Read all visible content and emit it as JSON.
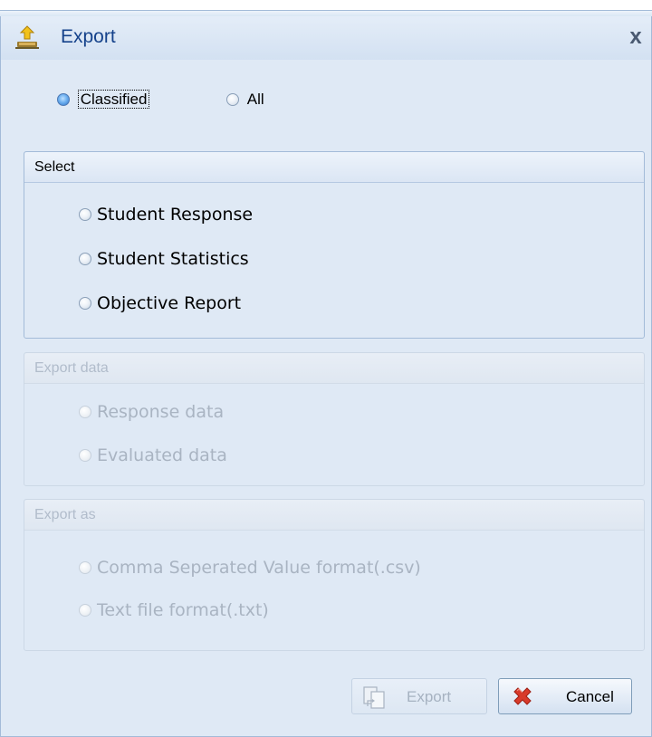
{
  "window": {
    "title": "Export",
    "close_label": "x"
  },
  "mode": {
    "options": [
      {
        "label": "Classified",
        "selected": true
      },
      {
        "label": "All",
        "selected": false
      }
    ]
  },
  "select_group": {
    "title": "Select",
    "options": [
      {
        "label": "Student Response"
      },
      {
        "label": "Student Statistics"
      },
      {
        "label": "Objective Report"
      }
    ]
  },
  "export_data_group": {
    "title": "Export data",
    "enabled": false,
    "options": [
      {
        "label": "Response data"
      },
      {
        "label": "Evaluated data"
      }
    ]
  },
  "export_as_group": {
    "title": "Export as",
    "enabled": false,
    "options": [
      {
        "label": "Comma Seperated Value format(.csv)"
      },
      {
        "label": "Text file format(.txt)"
      }
    ]
  },
  "buttons": {
    "export_label": "Export",
    "cancel_label": "Cancel"
  },
  "icons": {
    "app": "export-app-icon",
    "close": "close-icon",
    "export_button": "copy-export-icon",
    "cancel_button": "red-x-icon"
  },
  "colors": {
    "title_text": "#15428b",
    "frame_border": "#a3bbd8",
    "cancel_icon": "#d83a2a"
  }
}
